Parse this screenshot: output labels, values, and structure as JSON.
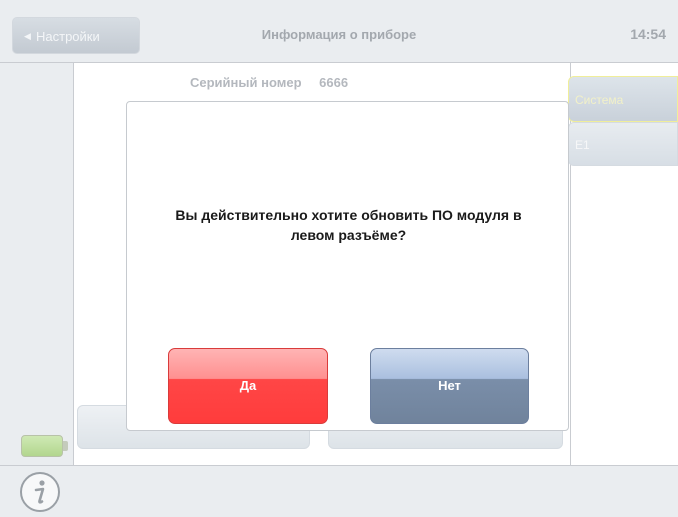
{
  "header": {
    "back_label": "Настройки",
    "title": "Информация о приборе",
    "clock": "14:54"
  },
  "main": {
    "serial_label": "Серийный номер",
    "serial_value": "6666"
  },
  "side_tabs": [
    {
      "label": "Система"
    },
    {
      "label": "E1"
    }
  ],
  "dialog": {
    "message": "Вы действительно хотите обновить ПО модуля в левом разъёме?",
    "yes_label": "Да",
    "no_label": "Нет"
  },
  "colors": {
    "yes_button": "#ff4646",
    "no_button": "#7a8ea9",
    "battery": "#b2d68e"
  },
  "icons": {
    "back": "left-triangle-icon",
    "info": "info-icon",
    "battery": "battery-icon"
  }
}
